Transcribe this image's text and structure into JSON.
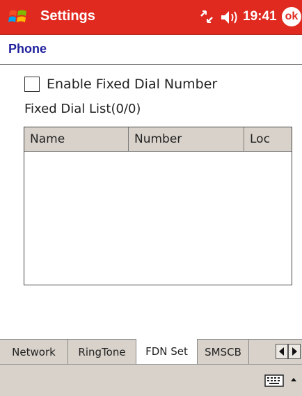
{
  "titlebar": {
    "title": "Settings",
    "time": "19:41",
    "ok_label": "ok",
    "start_icon": "windows-flag-icon",
    "connectivity_icon": "connectivity-icon",
    "volume_icon": "speaker-icon",
    "bg_color": "#e02a20"
  },
  "section": {
    "title": "Phone",
    "title_color": "#1f1f9c"
  },
  "fdn": {
    "checkbox_label": "Enable Fixed Dial Number",
    "checked": false,
    "list_caption": "Fixed Dial List(0/0)",
    "columns": [
      "Name",
      "Number",
      "Loc"
    ],
    "rows": []
  },
  "tabs": [
    {
      "label": "Network",
      "active": false
    },
    {
      "label": "RingTone",
      "active": false
    },
    {
      "label": "FDN Set",
      "active": true
    },
    {
      "label": "SMSCB",
      "active": false
    }
  ],
  "tab_scroll": {
    "left_icon": "triangle-left-icon",
    "right_icon": "triangle-right-icon"
  },
  "cmdbar": {
    "keyboard_icon": "keyboard-icon",
    "sip_icon": "chevron-up-icon"
  }
}
